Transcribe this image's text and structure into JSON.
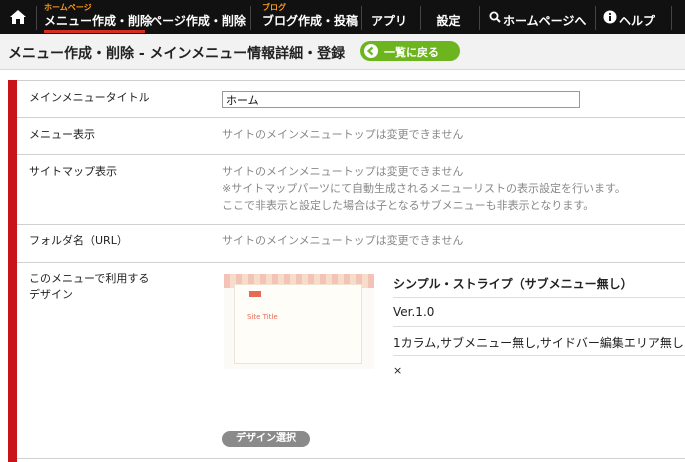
{
  "nav": {
    "items": [
      {
        "label": "メニュー作成・削除",
        "sublabel": "ホームページ",
        "active": true
      },
      {
        "label": "ページ作成・削除"
      },
      {
        "label": "ブログ作成・投稿",
        "sublabel": "ブログ"
      },
      {
        "label": "アプリ"
      },
      {
        "label": "設定"
      },
      {
        "label": "ホームページへ",
        "icon": "search-icon"
      },
      {
        "label": "ヘルプ",
        "icon": "info-icon"
      }
    ],
    "home_icon": "home-icon"
  },
  "header": {
    "title": "メニュー作成・削除 - メインメニュー情報詳細・登録",
    "back_button": "一覧に戻る"
  },
  "form": {
    "rows": [
      {
        "label": "メインメニュータイトル",
        "input_value": "ホーム"
      },
      {
        "label": "メニュー表示",
        "value": "サイトのメインメニュートップは変更できません"
      },
      {
        "label": "サイトマップ表示",
        "lines": [
          "サイトのメインメニュートップは変更できません",
          "※サイトマップパーツにて自動生成されるメニューリストの表示設定を行います。",
          "ここで非表示と設定した場合は子となるサブメニューも非表示となります。"
        ]
      },
      {
        "label": "フォルダ名（URL）",
        "value": "サイトのメインメニュートップは変更できません"
      },
      {
        "label_lines": [
          "このメニューで利用する",
          "デザイン"
        ]
      }
    ],
    "design": {
      "thumb_title": "Site Title",
      "name": "シンプル・ストライプ（サブメニュー無し）",
      "version": "Ver.1.0",
      "description": "1カラム,サブメニュー無し,サイドバー編集エリア無し",
      "close": "×",
      "select_button": "デザイン選択"
    }
  },
  "colors": {
    "nav_bg": "#111111",
    "accent_red": "#c8131b",
    "back_green": "#6cb51f",
    "sublabel_orange": "#ff9a1a"
  }
}
